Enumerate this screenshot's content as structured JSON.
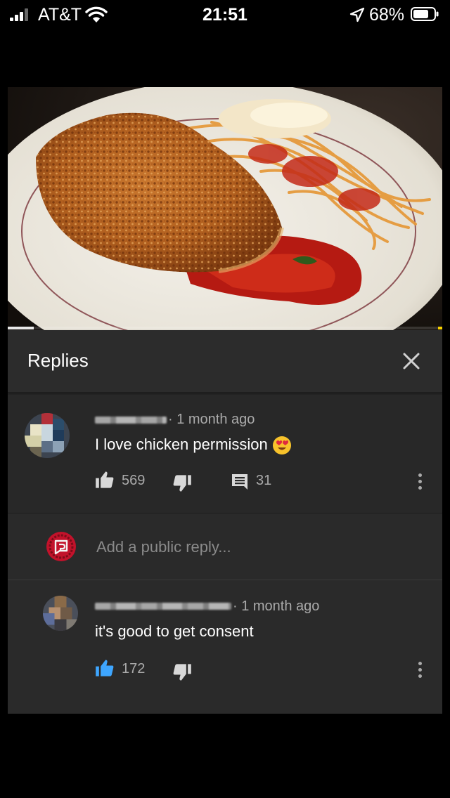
{
  "status_bar": {
    "carrier": "AT&T",
    "time": "21:51",
    "battery_percent": "68%"
  },
  "video": {
    "progress": 0.06
  },
  "panel": {
    "title": "Replies"
  },
  "top_comment": {
    "time": "· 1 month ago",
    "text": "I love chicken permission",
    "emoji": "smiling-face-with-heart-eyes",
    "likes": "569",
    "replies": "31"
  },
  "reply_box": {
    "placeholder": "Add a public reply..."
  },
  "reply": {
    "time": "· 1 month ago",
    "text": "it's good to get consent",
    "likes": "172",
    "liked": true
  },
  "colors": {
    "accent_blue": "#3ea6ff",
    "panel_bg": "#282828",
    "muted_text": "#aaaaaa"
  }
}
